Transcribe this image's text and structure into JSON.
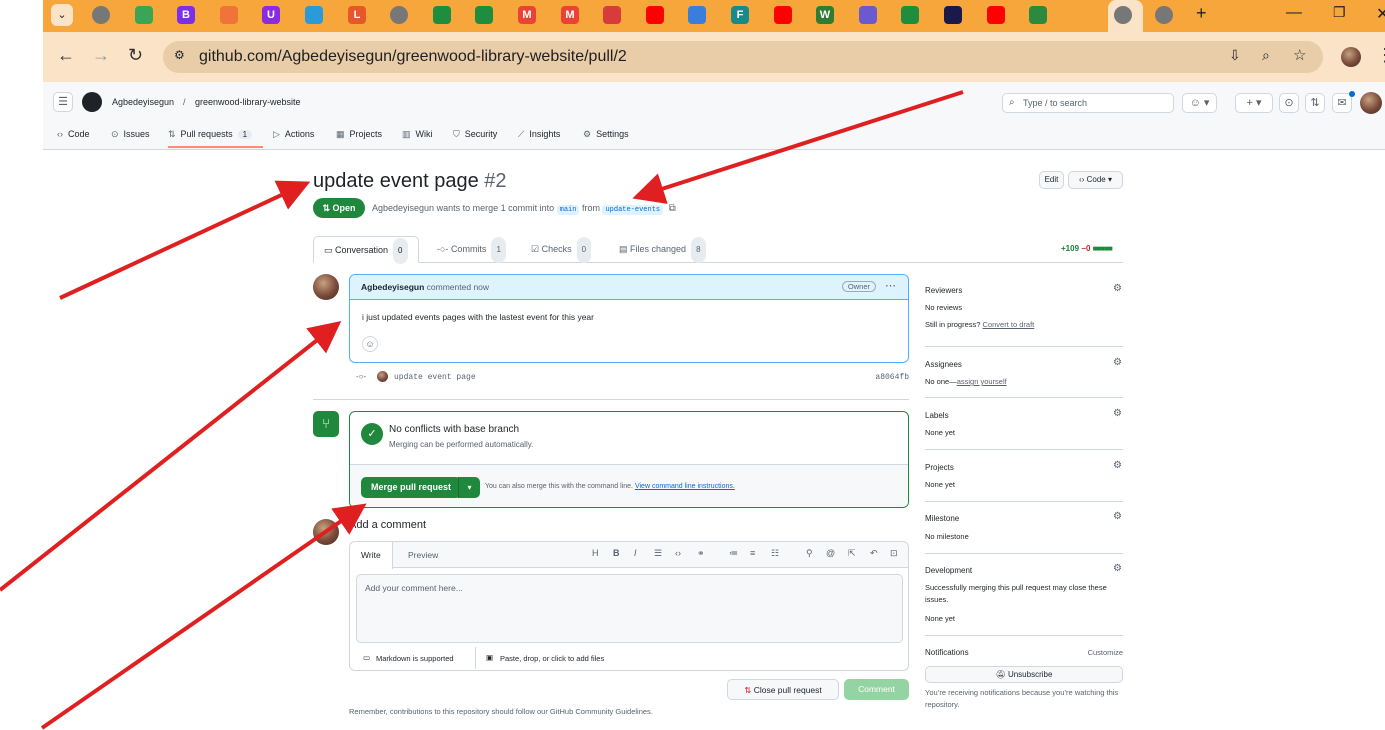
{
  "browser": {
    "url": "github.com/Agbedeyisegun/greenwood-library-website/pull/2",
    "tabs": [
      {
        "icon": "globe-icon",
        "color": "#777777",
        "glyph": ""
      },
      {
        "icon": "tab-favicon",
        "color": "#3aa655",
        "glyph": ""
      },
      {
        "icon": "bootstrap-icon",
        "color": "#7b2fe8",
        "glyph": "B"
      },
      {
        "icon": "tab-favicon",
        "color": "#f0743a",
        "glyph": ""
      },
      {
        "icon": "tab-favicon",
        "color": "#8a2be2",
        "glyph": "U"
      },
      {
        "icon": "tab-favicon",
        "color": "#2a9bd8",
        "glyph": ""
      },
      {
        "icon": "tab-favicon",
        "color": "#e8572a",
        "glyph": "L"
      },
      {
        "icon": "globe-icon",
        "color": "#777777",
        "glyph": ""
      },
      {
        "icon": "sheets-icon",
        "color": "#1e8e3e",
        "glyph": ""
      },
      {
        "icon": "sheets-icon",
        "color": "#1e8e3e",
        "glyph": ""
      },
      {
        "icon": "gmail-icon",
        "color": "#ea4335",
        "glyph": "M"
      },
      {
        "icon": "gmail-icon",
        "color": "#ea4335",
        "glyph": "M"
      },
      {
        "icon": "tab-favicon",
        "color": "#d83b3b",
        "glyph": ""
      },
      {
        "icon": "youtube-icon",
        "color": "#ff0000",
        "glyph": ""
      },
      {
        "icon": "tab-favicon",
        "color": "#3b7ddd",
        "glyph": ""
      },
      {
        "icon": "tab-favicon",
        "color": "#178a8a",
        "glyph": "F"
      },
      {
        "icon": "youtube-icon",
        "color": "#ff0000",
        "glyph": ""
      },
      {
        "icon": "tab-favicon",
        "color": "#2e7d32",
        "glyph": "W"
      },
      {
        "icon": "tab-favicon",
        "color": "#6a5acd",
        "glyph": ""
      },
      {
        "icon": "sheets-icon",
        "color": "#1e8e3e",
        "glyph": ""
      },
      {
        "icon": "tab-favicon",
        "color": "#1a1a4a",
        "glyph": ""
      },
      {
        "icon": "youtube-icon",
        "color": "#ff0000",
        "glyph": ""
      },
      {
        "icon": "tab-favicon",
        "color": "#2b8a3e",
        "glyph": ""
      }
    ]
  },
  "header": {
    "owner": "Agbedeyisegun",
    "separator": "/",
    "repo": "greenwood-library-website",
    "search_placeholder": "Type / to search"
  },
  "repo_nav": {
    "code": "Code",
    "issues": "Issues",
    "pull_requests": "Pull requests",
    "pull_requests_count": "1",
    "actions": "Actions",
    "projects": "Projects",
    "wiki": "Wiki",
    "security": "Security",
    "insights": "Insights",
    "settings": "Settings"
  },
  "pr": {
    "title": "update event page",
    "number": "#2",
    "state": "Open",
    "author": "Agbedeyisegun",
    "merge_text": "wants to merge 1 commit into",
    "base": "main",
    "from_word": "from",
    "head": "update-events",
    "edit_label": "Edit",
    "code_label": "Code"
  },
  "pr_tabs": {
    "conversation": "Conversation",
    "conversation_count": "0",
    "commits": "Commits",
    "commits_count": "1",
    "checks": "Checks",
    "checks_count": "0",
    "files": "Files changed",
    "files_count": "8",
    "additions": "+109",
    "deletions": "−0"
  },
  "comment": {
    "author": "Agbedeyisegun",
    "meta": "commented now",
    "role": "Owner",
    "body": "i just updated events pages with the lastest event for this year"
  },
  "commit": {
    "message": "update event page",
    "sha": "a8064fb"
  },
  "merge": {
    "title": "No conflicts with base branch",
    "subtitle": "Merging can be performed automatically.",
    "button": "Merge pull request",
    "hint": "You can also merge this with the command line.",
    "hint_link": "View command line instructions."
  },
  "add_comment": {
    "title": "Add a comment",
    "write": "Write",
    "preview": "Preview",
    "placeholder": "Add your comment here...",
    "markdown": "Markdown is supported",
    "attach": "Paste, drop, or click to add files",
    "close_button": "Close pull request",
    "comment_button": "Comment",
    "remember": "Remember, contributions to this repository should follow our GitHub Community Guidelines."
  },
  "sidebar": {
    "reviewers": "Reviewers",
    "no_reviews": "No reviews",
    "in_progress": "Still in progress?",
    "convert": "Convert to draft",
    "assignees": "Assignees",
    "no_one": "No one—",
    "assign_yourself": "assign yourself",
    "labels": "Labels",
    "labels_value": "None yet",
    "projects": "Projects",
    "projects_value": "None yet",
    "milestone": "Milestone",
    "milestone_value": "No milestone",
    "development": "Development",
    "development_text": "Successfully merging this pull request may close these issues.",
    "development_value": "None yet",
    "notifications": "Notifications",
    "customize": "Customize",
    "unsubscribe": "Unsubscribe",
    "notif_text": "You’re receiving notifications because you’re watching this repository."
  },
  "colors": {
    "annotation_arrow": "#e02020",
    "open_green": "#1f883d",
    "tabstrip": "#f7a63b"
  }
}
